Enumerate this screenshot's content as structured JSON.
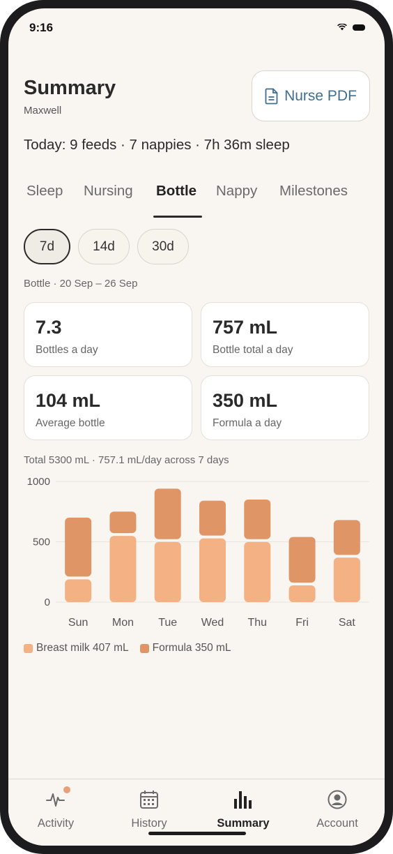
{
  "status_bar": {
    "time": "9:16"
  },
  "header": {
    "title": "Summary",
    "subtitle": "Maxwell",
    "pdf_button": "Nurse PDF",
    "today": "Today: 9 feeds · 7 nappies · 7h 36m sleep"
  },
  "tabs": [
    {
      "label": "Sleep",
      "active": false
    },
    {
      "label": "Nursing",
      "active": false
    },
    {
      "label": "Bottle",
      "active": true
    },
    {
      "label": "Nappy",
      "active": false
    },
    {
      "label": "Milestones",
      "active": false
    }
  ],
  "ranges": [
    {
      "label": "7d",
      "active": true
    },
    {
      "label": "14d",
      "active": false
    },
    {
      "label": "30d",
      "active": false
    }
  ],
  "range_caption": "Bottle · 20 Sep – 26 Sep",
  "stats": [
    {
      "value": "7.3",
      "label": "Bottles a day"
    },
    {
      "value": "757 mL",
      "label": "Bottle total a day"
    },
    {
      "value": "104 mL",
      "label": "Average bottle"
    },
    {
      "value": "350 mL",
      "label": "Formula a day"
    }
  ],
  "total_caption": "Total 5300 mL · 757.1 mL/day across 7 days",
  "colors": {
    "breast": "#f3b184",
    "formula": "#e09566",
    "accent": "#3f6f8f"
  },
  "chart_data": {
    "type": "bar",
    "stacked": true,
    "categories": [
      "Sun",
      "Mon",
      "Tue",
      "Wed",
      "Thu",
      "Fri",
      "Sat"
    ],
    "series": [
      {
        "name": "Breast milk",
        "values": [
          200,
          560,
          510,
          540,
          510,
          150,
          380
        ]
      },
      {
        "name": "Formula",
        "values": [
          500,
          190,
          430,
          300,
          340,
          390,
          300
        ]
      }
    ],
    "yticks": [
      "1000",
      "500",
      "0"
    ],
    "ylim": [
      0,
      1000
    ],
    "grid": true
  },
  "legend": [
    {
      "label": "Breast milk 407 mL",
      "color": "#f3b184"
    },
    {
      "label": "Formula 350 mL",
      "color": "#e09566"
    }
  ],
  "bottom_nav": [
    {
      "label": "Activity",
      "icon": "activity-icon",
      "active": false
    },
    {
      "label": "History",
      "icon": "calendar-icon",
      "active": false
    },
    {
      "label": "Summary",
      "icon": "bar-chart-icon",
      "active": true
    },
    {
      "label": "Account",
      "icon": "account-icon",
      "active": false
    }
  ]
}
